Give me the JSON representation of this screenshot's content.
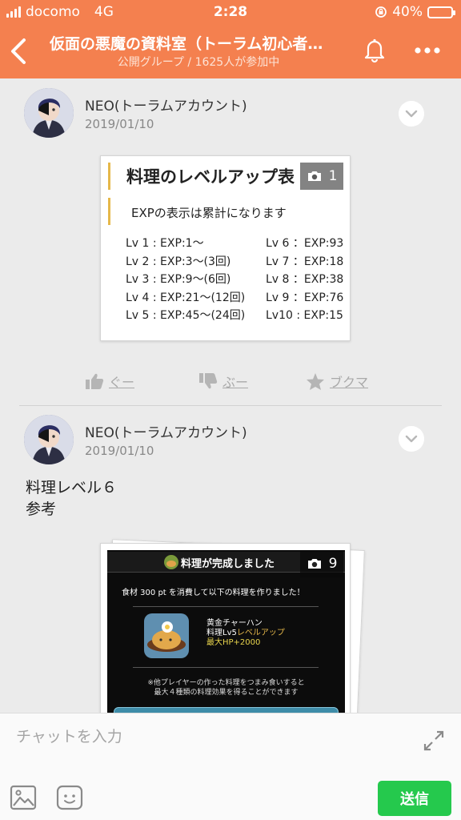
{
  "status_bar": {
    "carrier": "docomo",
    "network": "4G",
    "time": "2:28",
    "battery": "40%"
  },
  "header": {
    "title": "仮面の悪魔の資料室（トーラム初心者…",
    "subtitle": "公開グループ / 1625人が参加中"
  },
  "posts": [
    {
      "author": "NEO(トーラムアカウント)",
      "date": "2019/01/10",
      "image": {
        "photo_count": "1",
        "heading": "料理のレベルアップ表",
        "note": "EXPの表示は累計になります",
        "levels_left": [
          "Lv 1 : EXP:1〜",
          "Lv 2 : EXP:3〜(3回)",
          "Lv 3 : EXP:9〜(6回)",
          "Lv 4 : EXP:21〜(12回)",
          "Lv 5 : EXP:45〜(24回)"
        ],
        "levels_right": [
          "Lv 6 ：EXP:93",
          "Lv 7 ：EXP:18",
          "Lv 8 ：EXP:38",
          "Lv 9 ：EXP:76",
          "Lv10 : EXP:15"
        ]
      },
      "actions": {
        "good": "ぐー",
        "bad": "ぶー",
        "bookmark": "ブクマ"
      }
    },
    {
      "author": "NEO(トーラムアカウント)",
      "date": "2019/01/10",
      "text_line1": "料理レベル６",
      "text_line2": "参考",
      "image": {
        "photo_count": "9",
        "banner": "料理が完成しました",
        "desc": "食材 300 pt を消費して以下の料理を作りました！",
        "dish_name": "黄金チャーハン",
        "dish_level_prefix": "料理Lv5",
        "dish_level_suffix": "レベルアップ",
        "dish_effect": "最大HP+2000",
        "footer_line1": "※他プレイヤーの作った料理をつまみ食いすると",
        "footer_line2": "最大４種類の料理効果を得ることができます"
      }
    }
  ],
  "chat": {
    "placeholder": "チャットを入力",
    "send_label": "送信"
  },
  "colors": {
    "header_bg": "#f4804f",
    "send_bg": "#25c94d"
  }
}
